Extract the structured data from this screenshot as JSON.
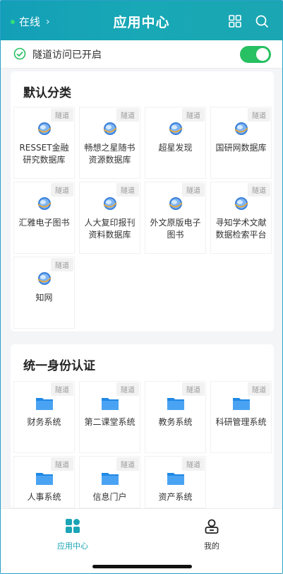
{
  "header": {
    "status": "在线",
    "title": "应用中心"
  },
  "tunnel": {
    "label": "隧道访问已开启",
    "enabled": true,
    "accent": "#27c062"
  },
  "sections": [
    {
      "title": "默认分类",
      "items": [
        {
          "name": "RESSET金融研究数据库",
          "tag": "隧道"
        },
        {
          "name": "畅想之星随书资源数据库",
          "tag": "隧道"
        },
        {
          "name": "超星发现",
          "tag": "隧道"
        },
        {
          "name": "国研网数据库",
          "tag": "隧道"
        },
        {
          "name": "汇雅电子图书",
          "tag": "隧道"
        },
        {
          "name": "人大复印报刊资料数据库",
          "tag": "隧道"
        },
        {
          "name": "外文原版电子图书",
          "tag": "隧道"
        },
        {
          "name": "寻知学术文献数据检索平台",
          "tag": "隧道"
        },
        {
          "name": "知网",
          "tag": "隧道"
        }
      ]
    },
    {
      "title": "统一身份认证",
      "items": [
        {
          "name": "财务系统",
          "tag": "隧道"
        },
        {
          "name": "第二课堂系统",
          "tag": "隧道"
        },
        {
          "name": "教务系统",
          "tag": "隧道"
        },
        {
          "name": "科研管理系统",
          "tag": "隧道"
        },
        {
          "name": "人事系统",
          "tag": "隧道"
        },
        {
          "name": "信息门户",
          "tag": "隧道"
        },
        {
          "name": "资产系统",
          "tag": "隧道"
        }
      ]
    }
  ],
  "nav": {
    "apps_label": "应用中心",
    "me_label": "我的"
  },
  "colors": {
    "header": "#18a3b6",
    "nav_active": "#1ba4b6",
    "folder": "#1f88e5"
  },
  "icons": {
    "globe": "globe-icon",
    "folder": "folder-icon",
    "grid": "grid-icon",
    "search": "search-icon",
    "check": "check-circle-icon",
    "person": "person-icon",
    "apps": "apps-icon"
  }
}
